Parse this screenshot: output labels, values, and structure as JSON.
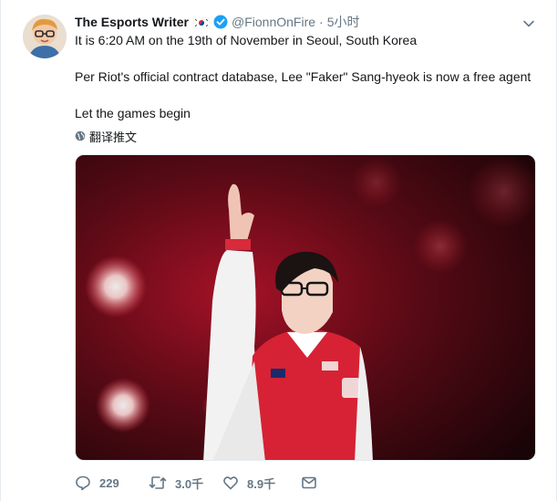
{
  "tweet": {
    "author_name": "The Esports Writer",
    "handle": "@FionnOnFire",
    "separator": "·",
    "time": "5小时",
    "lines": [
      "It is 6:20 AM on the 19th of November in Seoul, South Korea",
      "Per Riot's official contract database, Lee \"Faker\" Sang-hyeok is now a free agent",
      "Let the games begin"
    ],
    "translate_label": "翻译推文",
    "actions": {
      "reply_count": "229",
      "retweet_count": "3.0千",
      "like_count": "8.9千"
    }
  },
  "colors": {
    "accent": "#1da1f2",
    "muted": "#657786",
    "text": "#14171a"
  },
  "icons": {
    "reply": "reply-icon",
    "retweet": "retweet-icon",
    "like": "like-icon",
    "message": "message-icon",
    "verified": "verified-badge-icon",
    "flag": "korea-flag-icon",
    "caret": "chevron-down-icon",
    "translate": "globe-icon"
  }
}
